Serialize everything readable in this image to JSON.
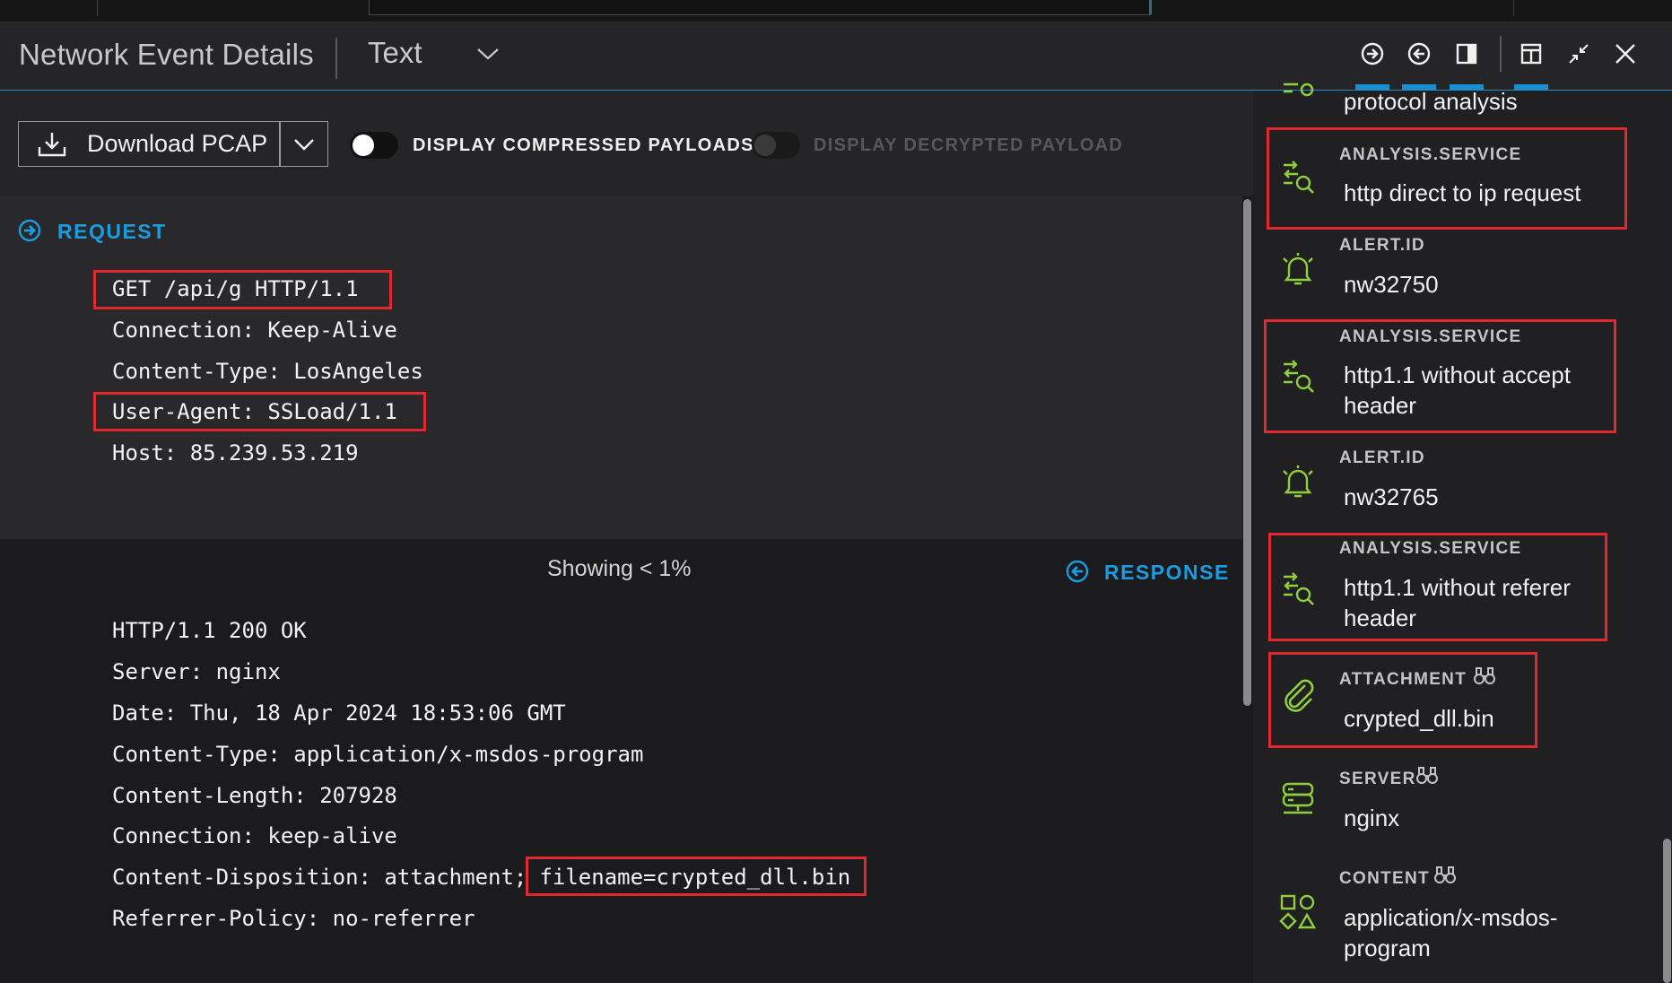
{
  "header": {
    "title": "Network Event Details",
    "view_mode": "Text",
    "icons": [
      "next-event-icon",
      "previous-event-icon",
      "toggle-side-panel-icon",
      "layout-icon",
      "collapse-icon",
      "close-icon"
    ]
  },
  "toolbar": {
    "download_label": "Download PCAP",
    "compressed_label": "DISPLAY COMPRESSED PAYLOADS",
    "decrypted_label": "DISPLAY DECRYPTED PAYLOAD"
  },
  "request": {
    "heading": "REQUEST",
    "lines": [
      "GET /api/g HTTP/1.1",
      "Connection: Keep-Alive",
      "Content-Type: LosAngeles",
      "User-Agent: SSLoad/1.1",
      "Host: 85.239.53.219"
    ]
  },
  "showing": "Showing < 1%",
  "response": {
    "heading": "RESPONSE",
    "lines": [
      "HTTP/1.1 200 OK",
      "Server: nginx",
      "Date: Thu, 18 Apr 2024 18:53:06 GMT",
      "Content-Type: application/x-msdos-program",
      "Content-Length: 207928",
      "Connection: keep-alive",
      "Content-Disposition: attachment;",
      "Referrer-Policy: no-referrer"
    ],
    "filename": " filename=crypted_dll.bin"
  },
  "side": {
    "top_partial": "protocol analysis",
    "items": [
      {
        "label": "ANALYSIS.SERVICE",
        "value": "http direct to ip request",
        "icon": "analysis-icon"
      },
      {
        "label": "ALERT.ID",
        "value": "nw32750",
        "icon": "alarm-bell-icon"
      },
      {
        "label": "ANALYSIS.SERVICE",
        "value": "http1.1 without accept header",
        "icon": "analysis-icon"
      },
      {
        "label": "ALERT.ID",
        "value": "nw32765",
        "icon": "alarm-bell-icon"
      },
      {
        "label": "ANALYSIS.SERVICE",
        "value": "http1.1 without referer header",
        "icon": "analysis-icon"
      },
      {
        "label": "ATTACHMENT",
        "value": "crypted_dll.bin",
        "icon": "paperclip-icon"
      },
      {
        "label": "SERVER",
        "value": "nginx",
        "icon": "server-icon"
      },
      {
        "label": "CONTENT",
        "value": "application/x-msdos-program",
        "icon": "content-shapes-icon"
      }
    ]
  },
  "colors": {
    "accent_blue": "#1a9de0",
    "highlight_red": "#e0282e",
    "icon_green": "#8fcf3c"
  }
}
